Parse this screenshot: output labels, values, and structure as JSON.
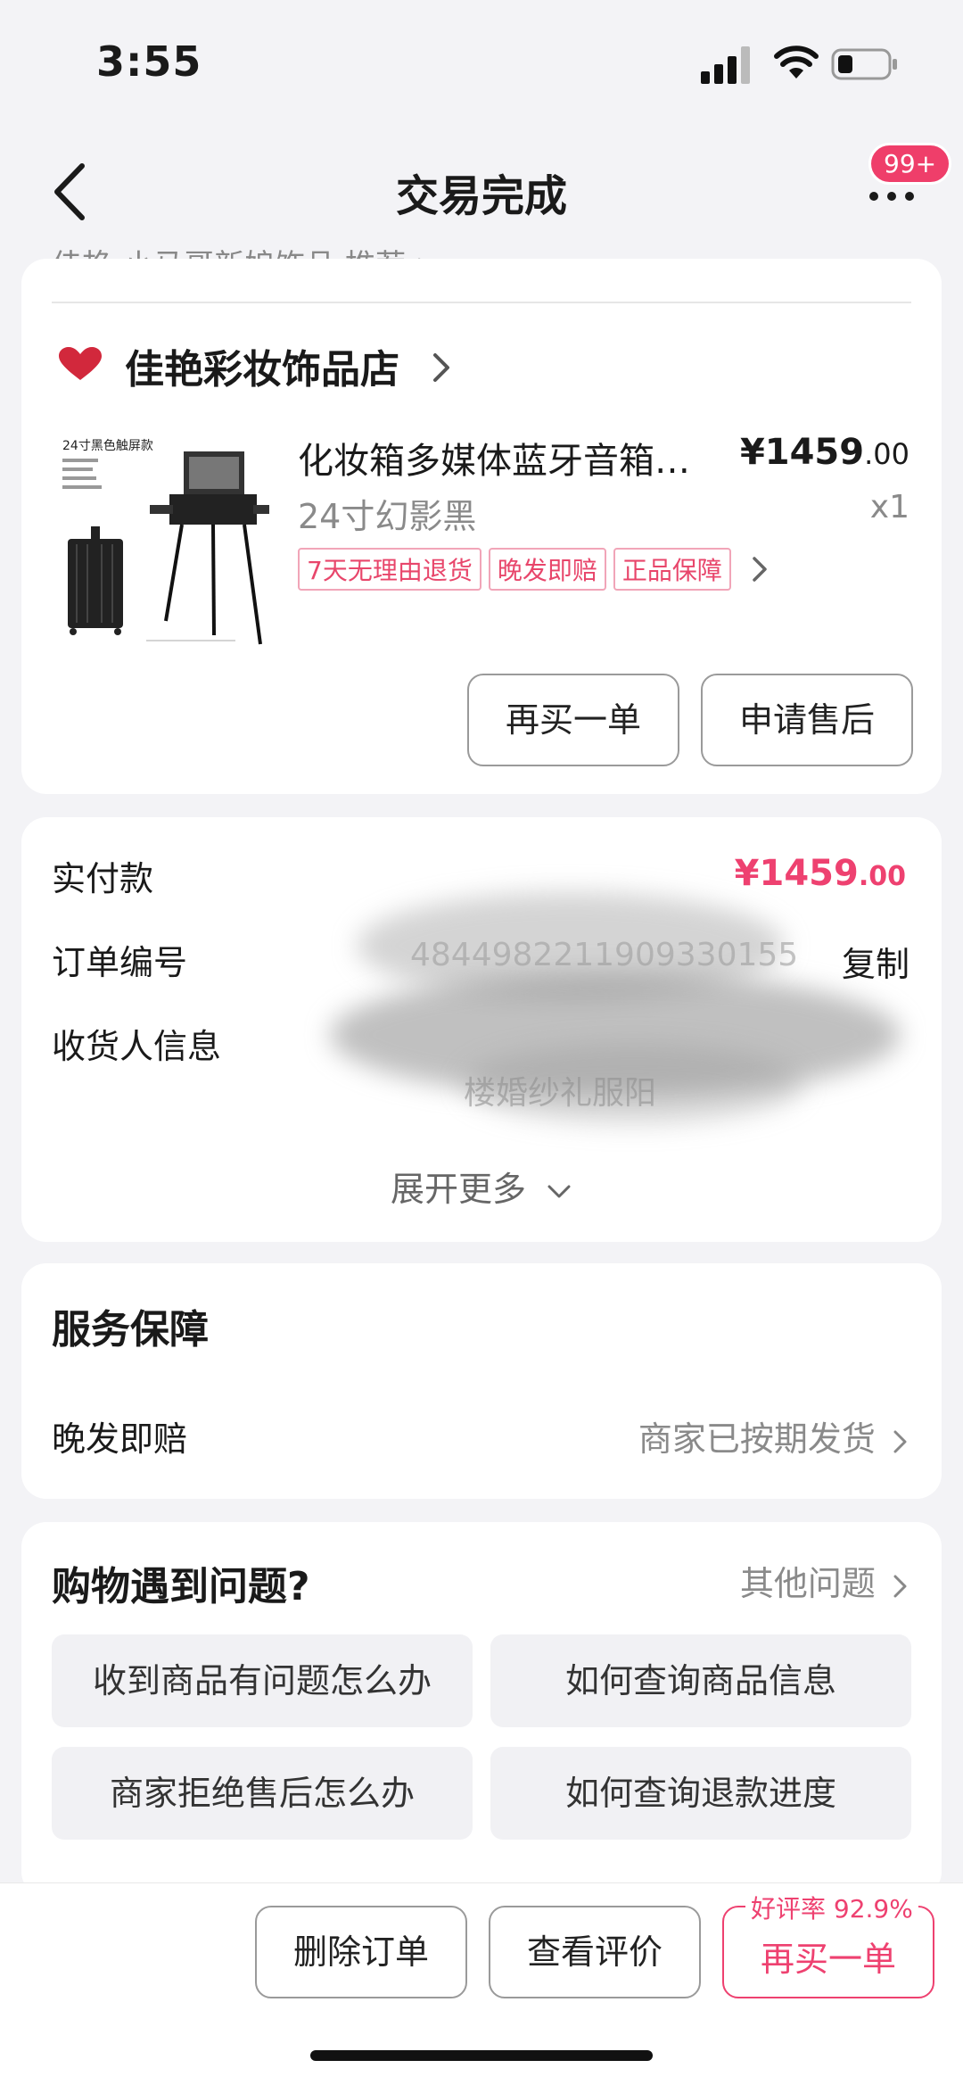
{
  "status_bar": {
    "time": "3:55"
  },
  "nav": {
    "title": "交易完成",
    "badge": "99+"
  },
  "peek_text": "佳艳-小马哥新娘饰品 推荐 >",
  "shop": {
    "name": "佳艳彩妆饰品店"
  },
  "product": {
    "title": "化妆箱多媒体蓝牙音箱…",
    "price_int": "¥1459",
    "price_dec": ".00",
    "variant": "24寸幻影黑",
    "qty": "x1",
    "tags": [
      "7天无理由退货",
      "晚发即赔",
      "正品保障"
    ],
    "image_caption": "24寸黑色触屏款"
  },
  "actions": {
    "buy_again": "再买一单",
    "after_sale": "申请售后"
  },
  "order_info": {
    "paid_label": "实付款",
    "paid_int": "¥1459",
    "paid_dec": ".00",
    "order_no_label": "订单编号",
    "order_no_value": "4844982211909330155",
    "copy_label": "复制",
    "receiver_label": "收货人信息",
    "address_fragment": "楼婚纱礼服阳",
    "expand_label": "展开更多"
  },
  "service": {
    "title": "服务保障",
    "row_label": "晚发即赔",
    "row_value": "商家已按期发货"
  },
  "help": {
    "title": "购物遇到问题?",
    "other_link": "其他问题",
    "q1": "收到商品有问题怎么办",
    "q2": "如何查询商品信息",
    "q3": "商家拒绝售后怎么办",
    "q4": "如何查询退款进度"
  },
  "bottom": {
    "delete": "删除订单",
    "review": "查看评价",
    "buy_again": "再买一单",
    "rating": "好评率 92.9%"
  },
  "colors": {
    "accent": "#ee4170",
    "background": "#f3f3f6"
  }
}
